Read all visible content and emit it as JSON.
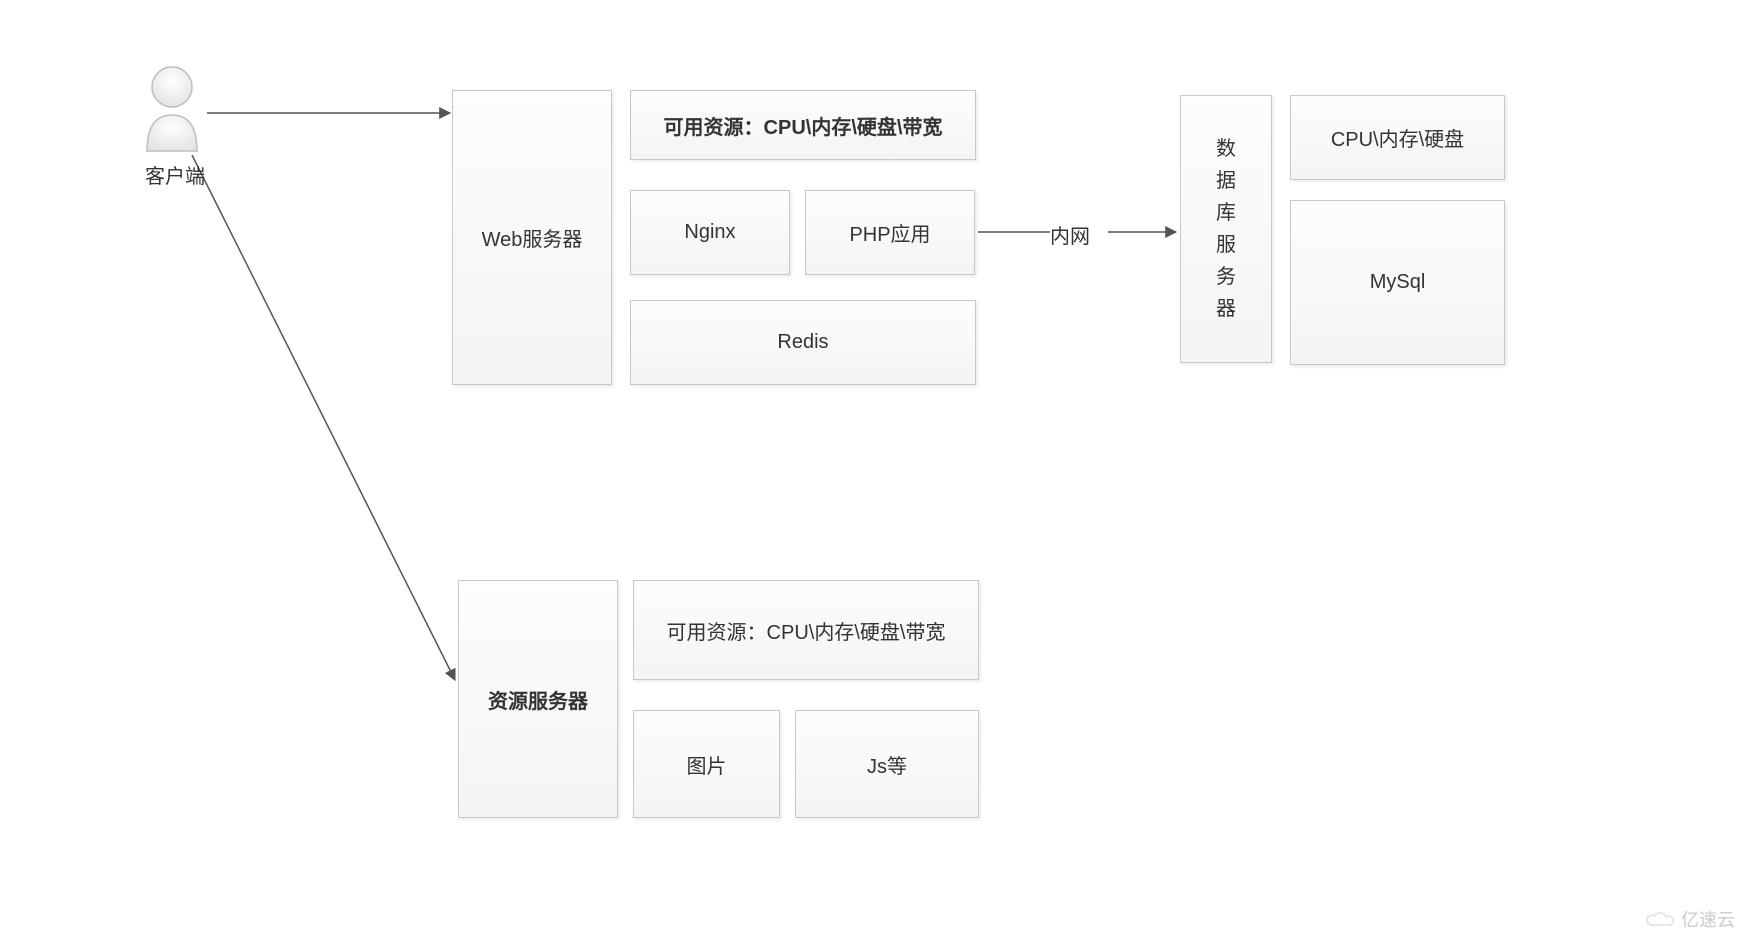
{
  "client": {
    "label": "客户端"
  },
  "webServer": {
    "title": "Web服务器",
    "resources": "可用资源：CPU\\内存\\硬盘\\带宽",
    "nginx": "Nginx",
    "php": "PHP应用",
    "redis": "Redis"
  },
  "link": {
    "intranet": "内网"
  },
  "dbServer": {
    "title": "数据库服务器",
    "spec": "CPU\\内存\\硬盘",
    "db": "MySql"
  },
  "resourceServer": {
    "title": "资源服务器",
    "resources": "可用资源：CPU\\内存\\硬盘\\带宽",
    "img": "图片",
    "js": "Js等"
  },
  "watermark": "亿速云"
}
